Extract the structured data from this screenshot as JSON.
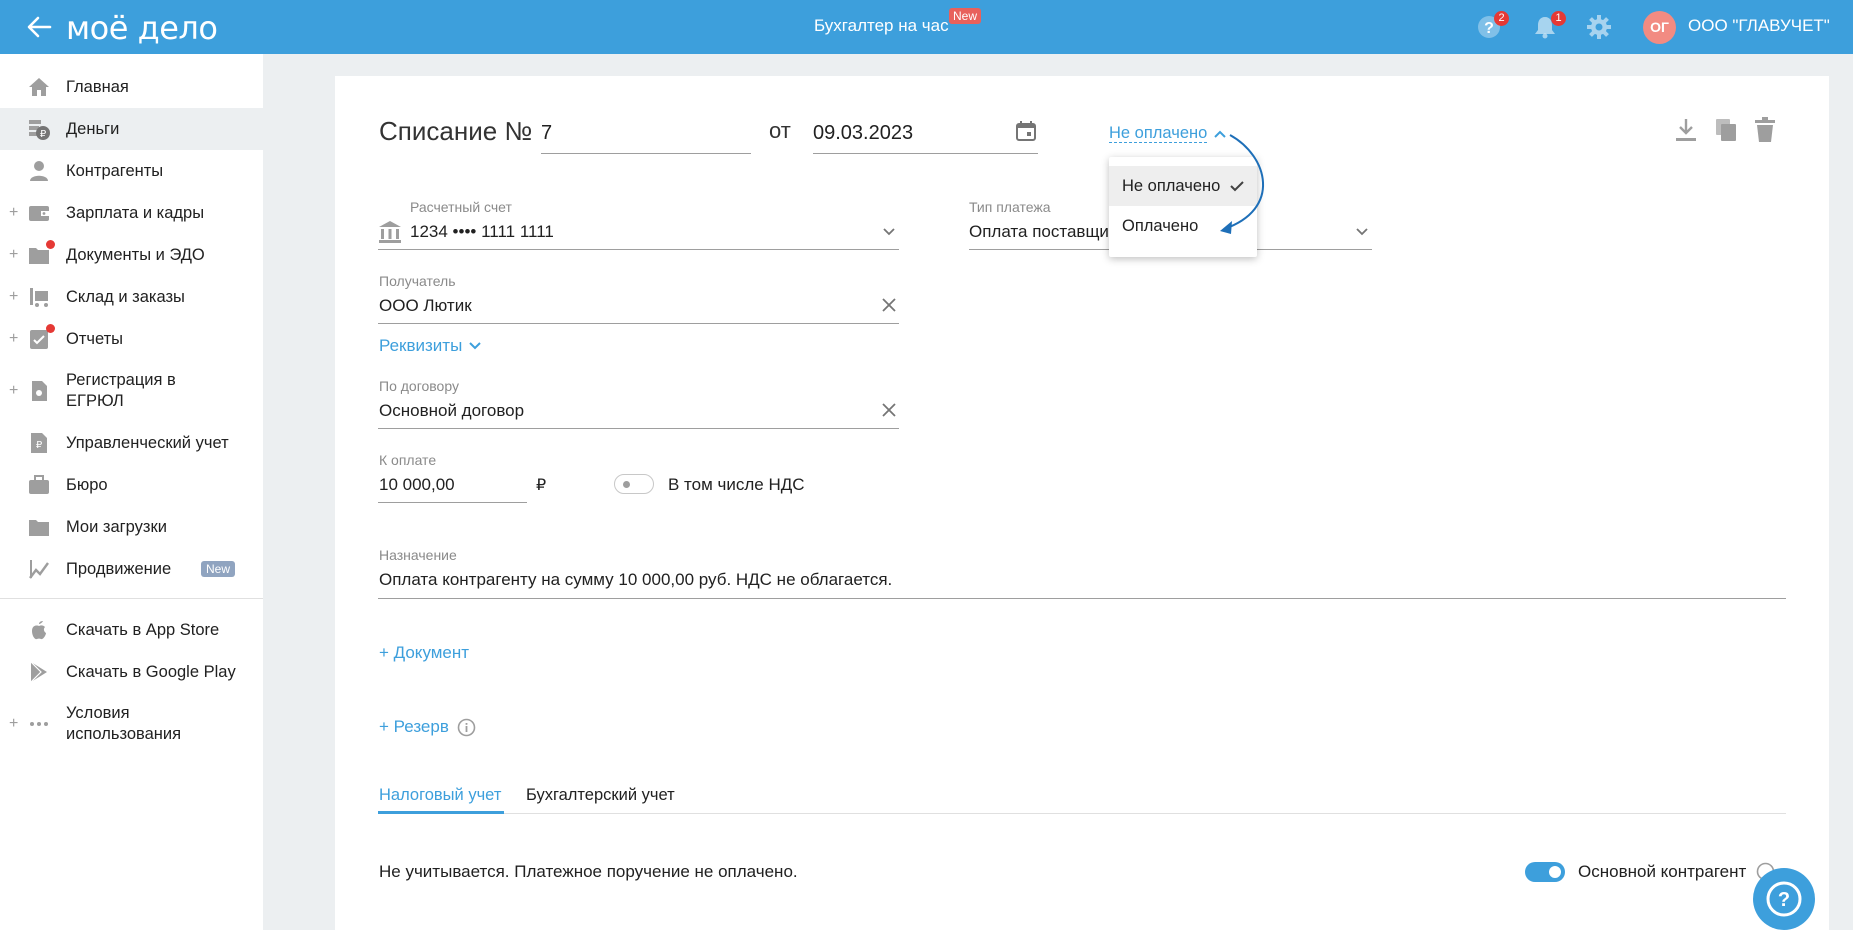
{
  "header": {
    "logo": "моё дело",
    "center_link": "Бухгалтер на час",
    "center_badge": "New",
    "help_count": "2",
    "notifications_count": "1",
    "avatar_initials": "ОГ",
    "company_name": "ООО \"ГЛАВУЧЕТ\""
  },
  "sidebar": {
    "items": [
      {
        "label": "Главная"
      },
      {
        "label": "Деньги"
      },
      {
        "label": "Контрагенты"
      },
      {
        "label": "Зарплата и кадры"
      },
      {
        "label": "Документы и ЭДО"
      },
      {
        "label": "Склад и заказы"
      },
      {
        "label": "Отчеты"
      },
      {
        "label": "Регистрация в ЕГРЮЛ"
      },
      {
        "label": "Управленческий учет"
      },
      {
        "label": "Бюро"
      },
      {
        "label": "Мои загрузки"
      },
      {
        "label": "Продвижение",
        "badge": "New"
      }
    ],
    "extra": [
      {
        "label": "Скачать в App Store"
      },
      {
        "label": "Скачать в Google Play"
      },
      {
        "label": "Условия использования"
      }
    ]
  },
  "document": {
    "title": "Списание №",
    "number": "7",
    "from_label": "от",
    "date": "09.03.2023",
    "status": "Не оплачено",
    "status_options": [
      "Не оплачено",
      "Оплачено"
    ],
    "account_label": "Расчетный счет",
    "account_value": "1234 •••• 1111 1111",
    "payment_type_label": "Тип платежа",
    "payment_type_value": "Оплата поставщи",
    "recipient_label": "Получатель",
    "recipient_value": "ООО Лютик",
    "requisites_link": "Реквизиты",
    "contract_label": "По договору",
    "contract_value": "Основной договор",
    "amount_label": "К оплате",
    "amount_value": "10 000,00",
    "currency": "₽",
    "vat_label": "В том числе НДС",
    "purpose_label": "Назначение",
    "purpose_value": "Оплата контрагенту на сумму 10 000,00 руб. НДС не облагается.",
    "add_document": "+ Документ",
    "add_reserve": "+ Резерв",
    "tabs": [
      "Налоговый учет",
      "Бухгалтерский учет"
    ],
    "tax_note": "Не учитывается. Платежное поручение не оплачено.",
    "main_counterparty_label": "Основной контрагент"
  },
  "colors": {
    "brand_blue": "#3d9fdc",
    "badge_red": "#e53935"
  }
}
